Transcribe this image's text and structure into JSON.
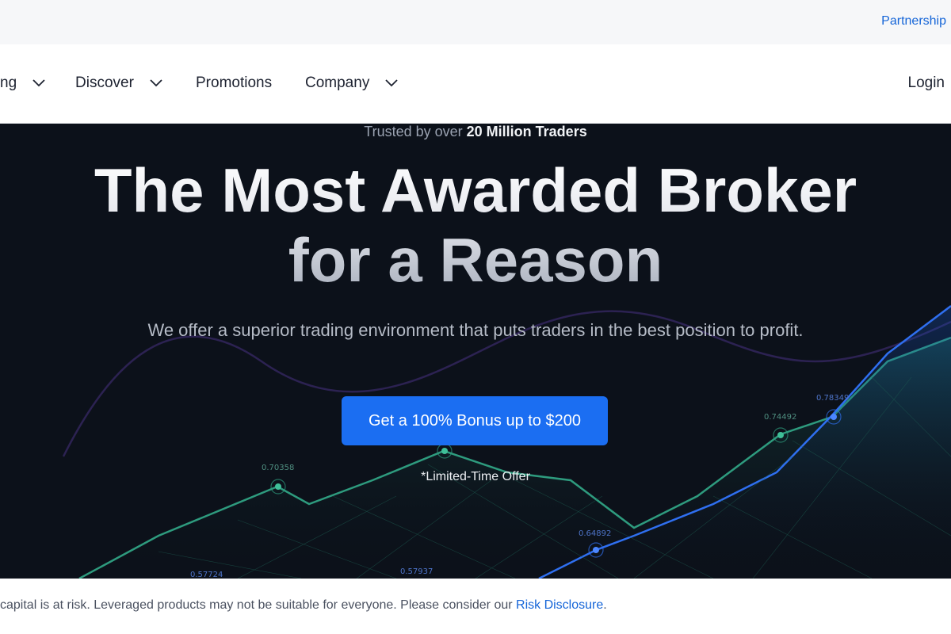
{
  "topbar": {
    "partnership": "Partnership"
  },
  "nav": {
    "items": [
      {
        "label": "ng"
      },
      {
        "label": "Discover"
      },
      {
        "label": "Promotions"
      },
      {
        "label": "Company"
      }
    ],
    "login": "Login"
  },
  "hero": {
    "trusted_prefix": "Trusted by over ",
    "trusted_strong": "20 Million Traders",
    "headline_line1": "The Most Awarded Broker",
    "headline_line2": "for a Reason",
    "subheadline": "We offer a superior trading environment that puts traders in the best position to profit.",
    "cta_label": "Get a 100% Bonus up to $200",
    "offer_note": "*Limited-Time Offer",
    "chart_labels": [
      "0.70358",
      "0.74492",
      "0.78349",
      "0.64892",
      "0.57724",
      "0.57937"
    ]
  },
  "risk": {
    "text": "capital is at risk. Leveraged products may not be suitable for everyone. Please consider our ",
    "link": "Risk Disclosure",
    "end": "."
  },
  "colors": {
    "accent": "#1b6ef2",
    "link": "#1565d8",
    "hero_bg": "#0c111a"
  }
}
